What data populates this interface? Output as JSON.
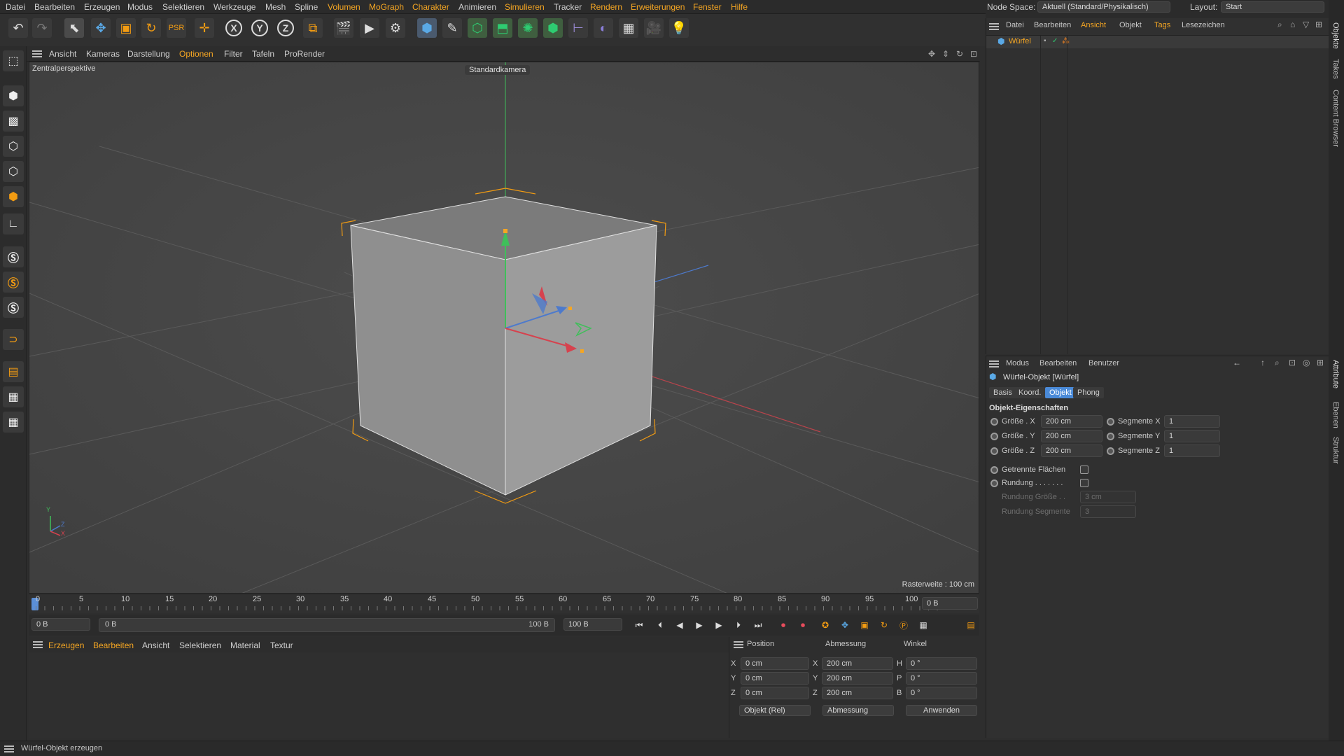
{
  "menu": {
    "items": [
      "Datei",
      "Bearbeiten",
      "Erzeugen",
      "Modus",
      "Selektieren",
      "Werkzeuge",
      "Mesh",
      "Spline",
      "Volumen",
      "MoGraph",
      "Charakter",
      "Animieren",
      "Simulieren",
      "Tracker",
      "Rendern",
      "Erweiterungen",
      "Fenster",
      "Hilfe"
    ],
    "node_space_label": "Node Space:",
    "node_space_value": "Aktuell (Standard/Physikalisch)",
    "layout_label": "Layout:",
    "layout_value": "Start"
  },
  "toolbar": {
    "icons": [
      "undo-icon",
      "redo-icon",
      "select-icon",
      "move-icon",
      "scale-icon",
      "rotate-icon",
      "psr-icon",
      "add-icon",
      "axis-x-icon",
      "axis-y-icon",
      "axis-z-icon",
      "coord-system-icon",
      "render-region-icon",
      "render-view-icon",
      "render-settings-icon",
      "cube-icon",
      "pen-icon",
      "subdivision-icon",
      "extrude-icon",
      "array-icon",
      "cloner-icon",
      "deformer-icon",
      "nurbs-icon",
      "floor-icon",
      "camera-icon",
      "light-icon"
    ],
    "axis_x": "X",
    "axis_y": "Y",
    "axis_z": "Z"
  },
  "left_tools": [
    "make-editable-icon",
    "model-mode-icon",
    "texture-mode-icon",
    "points-mode-icon",
    "edges-mode-icon",
    "polygons-mode-icon",
    "axis-mode-icon",
    "snap-s-icon",
    "snap-s-orange-icon",
    "snap-s-icon-2",
    "magnet-icon",
    "workplane-icon",
    "lock-workplane-icon",
    "grid-snap-icon"
  ],
  "viewport": {
    "menu": [
      "Ansicht",
      "Kameras",
      "Darstellung",
      "Optionen",
      "Filter",
      "Tafeln",
      "ProRender"
    ],
    "perspective": "Zentralperspektive",
    "camera": "Standardkamera",
    "grid_spacing": "Rasterweite : 100 cm",
    "axis_y": "Y",
    "axis_z": "Z",
    "axis_x": "X"
  },
  "timeline": {
    "ticks": [
      "0",
      "5",
      "10",
      "15",
      "20",
      "25",
      "30",
      "35",
      "40",
      "45",
      "50",
      "55",
      "60",
      "65",
      "70",
      "75",
      "80",
      "85",
      "90",
      "95",
      "100"
    ],
    "current_frame": "0 B",
    "start_field": "0 B",
    "range_start": "0 B",
    "range_end": "100 B",
    "end_field": "100 B"
  },
  "material_manager": {
    "menu": [
      "Erzeugen",
      "Bearbeiten",
      "Ansicht",
      "Selektieren",
      "Material",
      "Textur"
    ]
  },
  "coordinates": {
    "headers": [
      "Position",
      "Abmessung",
      "Winkel"
    ],
    "rows": [
      {
        "axis": "X",
        "pos": "0 cm",
        "size_axis": "X",
        "size": "200 cm",
        "rot_axis": "H",
        "rot": "0 °"
      },
      {
        "axis": "Y",
        "pos": "0 cm",
        "size_axis": "Y",
        "size": "200 cm",
        "rot_axis": "P",
        "rot": "0 °"
      },
      {
        "axis": "Z",
        "pos": "0 cm",
        "size_axis": "Z",
        "size": "200 cm",
        "rot_axis": "B",
        "rot": "0 °"
      }
    ],
    "mode_select": "Objekt (Rel)",
    "size_select": "Abmessung",
    "apply_button": "Anwenden"
  },
  "object_manager": {
    "menu": [
      "Datei",
      "Bearbeiten",
      "Ansicht",
      "Objekt",
      "Tags",
      "Lesezeichen"
    ],
    "objects": [
      {
        "name": "Würfel"
      }
    ]
  },
  "attributes": {
    "menu": [
      "Modus",
      "Bearbeiten",
      "Benutzer"
    ],
    "title": "Würfel-Objekt [Würfel]",
    "tabs": [
      "Basis",
      "Koord.",
      "Objekt",
      "Phong"
    ],
    "active_tab": "Objekt",
    "section": "Objekt-Eigenschaften",
    "size_rows": [
      {
        "label": "Größe . X",
        "value": "200 cm",
        "seg_label": "Segmente X",
        "seg_value": "1"
      },
      {
        "label": "Größe . Y",
        "value": "200 cm",
        "seg_label": "Segmente Y",
        "seg_value": "1"
      },
      {
        "label": "Größe . Z",
        "value": "200 cm",
        "seg_label": "Segmente Z",
        "seg_value": "1"
      }
    ],
    "separate_faces": "Getrennte Flächen",
    "fillet": "Rundung . . . . . . .",
    "fillet_radius_label": "Rundung Größe . .",
    "fillet_radius_value": "3 cm",
    "fillet_subdiv_label": "Rundung Segmente",
    "fillet_subdiv_value": "3"
  },
  "side_tabs": [
    "Objekte",
    "Takes",
    "Content Browser",
    "Attribute",
    "Ebenen",
    "Struktur"
  ],
  "status": "Würfel-Objekt erzeugen",
  "colors": {
    "accent": "#f5a623",
    "active_tab": "#4a8ad8",
    "axis_x": "#d6424e",
    "axis_y": "#3fbf5a",
    "axis_z": "#3d74d6"
  }
}
